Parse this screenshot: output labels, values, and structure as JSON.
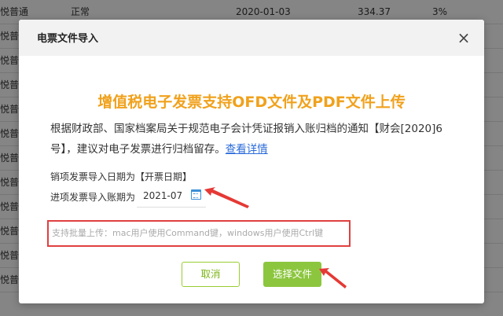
{
  "background": {
    "rows": [
      {
        "col1": "悦普通",
        "col2": "正常",
        "col3": "2020-01-03",
        "col4": "334.37",
        "col5": "3%"
      },
      {
        "col1": "悦普通"
      },
      {
        "col1": "悦普通"
      },
      {
        "col1": "悦普通"
      },
      {
        "col1": "悦普通"
      },
      {
        "col1": "悦普通"
      },
      {
        "col1": "悦普通"
      },
      {
        "col1": "悦普通"
      },
      {
        "col1": "悦普通"
      },
      {
        "col1": "悦普通"
      },
      {
        "col1": "悦普通"
      },
      {
        "col1": "悦普通"
      }
    ]
  },
  "dialog": {
    "title": "电票文件导入",
    "close_glyph": "×",
    "headline": "增值税电子发票支持OFD文件及PDF文件上传",
    "notice_text": "根据财政部、国家档案局关于规范电子会计凭证报销入账归档的通知【财会[2020]6号】，建议对电子发票进行归档留存。",
    "notice_link": "查看详情",
    "sales_label": "销项发票导入日期为【开票日期】",
    "purchase_label": "进项发票导入账期为",
    "period_value": "2021-07",
    "upload_hint": "支持批量上传：mac用户使用Command键，windows用户使用Ctrl键",
    "cancel_label": "取消",
    "choose_label": "选择文件"
  },
  "colors": {
    "headline": "#f0a11c",
    "accent_green": "#8cc63f",
    "link": "#2d6ddb",
    "highlight_border": "#e04040"
  }
}
